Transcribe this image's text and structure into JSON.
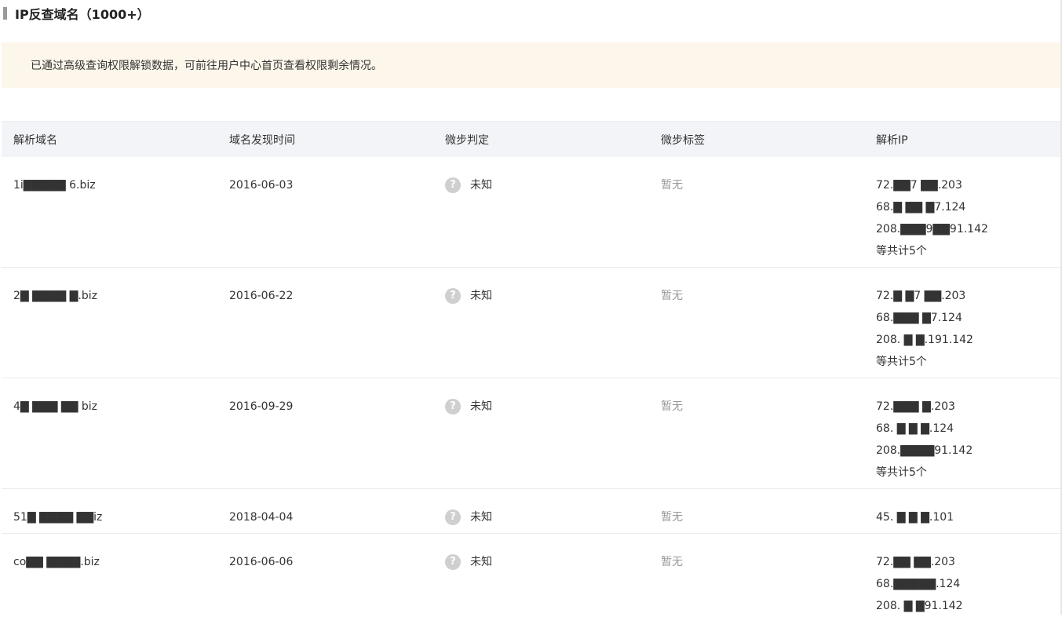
{
  "section": {
    "title": "IP反查域名（1000+）"
  },
  "notice": {
    "text": "已通过高级查询权限解锁数据，可前往用户中心首页查看权限剩余情况。"
  },
  "table": {
    "headers": [
      "解析域名",
      "域名发现时间",
      "微步判定",
      "微步标签",
      "解析IP"
    ],
    "rows": [
      {
        "domain": "1i▇▇▇▇▇ 6.biz",
        "date": "2016-06-03",
        "judgement": "未知",
        "tag": "暂无",
        "ips": [
          "72.▇▇7 ▇▇.203",
          "68.▇ ▇▇ ▇7.124",
          "208.▇▇▇9▇▇91.142"
        ],
        "more": "等共计5个"
      },
      {
        "domain": "2▇ ▇▇▇▇ ▇.biz",
        "date": "2016-06-22",
        "judgement": "未知",
        "tag": "暂无",
        "ips": [
          "72.▇ ▇7 ▇▇.203",
          "68.▇▇▇ ▇7.124",
          "208. ▇ ▇.191.142"
        ],
        "more": "等共计5个"
      },
      {
        "domain": "4▇ ▇▇▇ ▇▇ biz",
        "date": "2016-09-29",
        "judgement": "未知",
        "tag": "暂无",
        "ips": [
          "72.▇▇▇ ▇.203",
          "68. ▇ ▇ ▇.124",
          "208.▇▇▇▇91.142"
        ],
        "more": "等共计5个"
      },
      {
        "domain": "51▇ ▇▇▇▇ ▇▇iz",
        "date": "2018-04-04",
        "judgement": "未知",
        "tag": "暂无",
        "ips": [
          "45. ▇ ▇ ▇.101"
        ],
        "more": ""
      },
      {
        "domain": "co▇▇ ▇▇▇▇.biz",
        "date": "2016-06-06",
        "judgement": "未知",
        "tag": "暂无",
        "ips": [
          "72.▇▇ ▇▇.203",
          "68.▇▇▇▇▇.124",
          "208. ▇ ▇91.142"
        ],
        "more": ""
      }
    ]
  },
  "icons": {
    "judgement": "question-circle-icon"
  },
  "colors": {
    "notice_bg": "#fdf6ea",
    "header_bg": "#f3f4f7",
    "icon_gray": "#cfcfcf",
    "tag_gray": "#9a9a9a"
  }
}
